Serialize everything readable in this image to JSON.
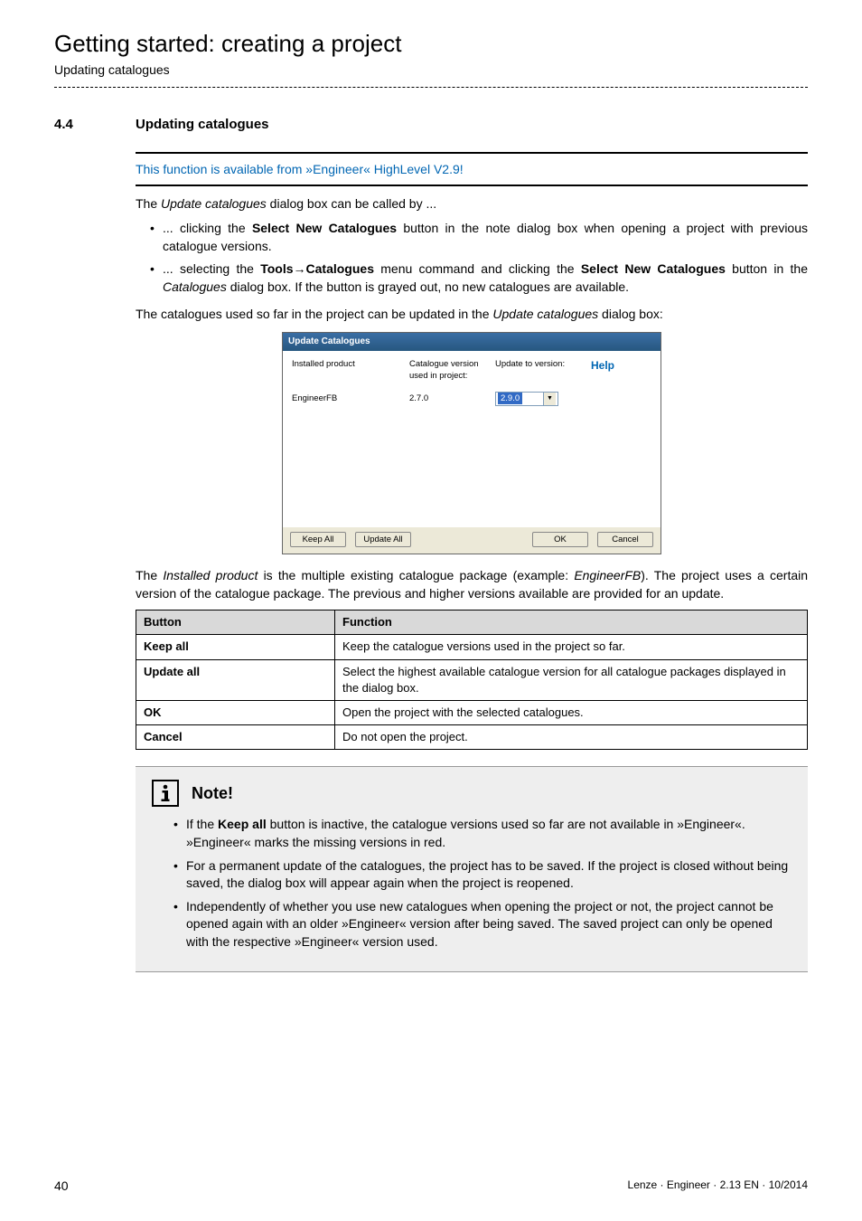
{
  "header": {
    "chapter_title": "Getting started: creating a project",
    "sub_title": "Updating catalogues"
  },
  "section": {
    "number": "4.4",
    "title": "Updating catalogues"
  },
  "blue_note": "This function is available from »Engineer« HighLevel V2.9!",
  "para1_pre": "The ",
  "para1_em": "Update catalogues",
  "para1_post": " dialog box can be called by ...",
  "bullets1": [
    {
      "pre": "... clicking the ",
      "bold1": "Select New Catalogues",
      "post": " button in the note dialog box when opening a project with previous catalogue versions."
    },
    {
      "pre": "... selecting the ",
      "bold1": "Tools",
      "arrow": "→",
      "bold2": "Catalogues",
      "mid": " menu command and clicking the ",
      "bold3": "Select New Catalogues",
      "post2_pre": " button in the ",
      "post2_em": "Catalogues",
      "post2_post": " dialog box. If the button is grayed out, no new catalogues are available."
    }
  ],
  "para2_pre": "The catalogues used so far in the project can be updated in the ",
  "para2_em": "Update catalogues",
  "para2_post": "  dialog box:",
  "screenshot": {
    "title": "Update Catalogues",
    "col1": "Installed product",
    "col2": "Catalogue version used in project:",
    "col3": "Update to version:",
    "help": "Help",
    "row_product": "EngineerFB",
    "row_version": "2.7.0",
    "row_new": "2.9.0",
    "btn_keep": "Keep All",
    "btn_update": "Update All",
    "btn_ok": "OK",
    "btn_cancel": "Cancel"
  },
  "para3_pre": "The ",
  "para3_em1": "Installed product",
  "para3_mid": " is the multiple existing catalogue package (example: ",
  "para3_em2": "EngineerFB",
  "para3_post": "). The project uses a certain version of the catalogue package. The previous and higher versions available are provided for an update.",
  "table": {
    "h1": "Button",
    "h2": "Function",
    "rows": [
      {
        "c1": "Keep all",
        "c2": "Keep the catalogue versions used in the project so far."
      },
      {
        "c1": "Update all",
        "c2": "Select the highest available catalogue version for all catalogue packages displayed in the dialog box."
      },
      {
        "c1": "OK",
        "c2": "Open the project with the selected catalogues."
      },
      {
        "c1": "Cancel",
        "c2": "Do not open the project."
      }
    ]
  },
  "note": {
    "title": "Note!",
    "items": [
      {
        "pre": "If the ",
        "bold": "Keep all",
        "post": " button is inactive, the catalogue versions used so far are not available in »Engineer«. »Engineer« marks the missing versions in red."
      },
      {
        "text": "For a permanent update of the catalogues, the project has to be saved. If the project is closed without being saved, the dialog box will appear again when the project is reopened."
      },
      {
        "text": "Independently of whether you use new catalogues when opening the project or not, the project cannot be opened again with an older »Engineer« version after being saved. The saved project can only be opened with the respective »Engineer« version used."
      }
    ]
  },
  "footer": {
    "page": "40",
    "doc": "Lenze · Engineer · 2.13 EN · 10/2014"
  }
}
